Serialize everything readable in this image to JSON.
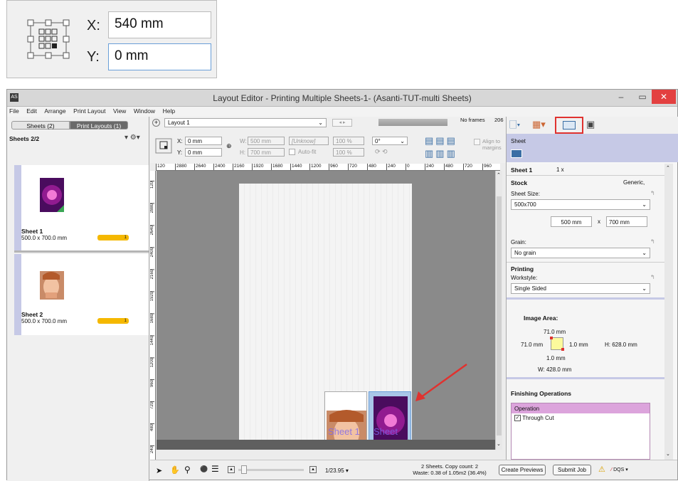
{
  "zoom": {
    "x_label": "X:",
    "x_value": "540 mm",
    "y_label": "Y:",
    "y_value": "0 mm"
  },
  "window": {
    "icon": "AS",
    "title": "Layout Editor - Printing Multiple Sheets-1- (Asanti-TUT-multi Sheets)"
  },
  "menu": [
    "File",
    "Edit",
    "Arrange",
    "Print Layout",
    "View",
    "Window",
    "Help"
  ],
  "left_tabs": {
    "sheets": "Sheets (2)",
    "layouts": "Print Layouts (1)"
  },
  "sheets_count": "Sheets 2/2",
  "sheets": [
    {
      "name": "Sheet 1",
      "size": "500.0 x 700.0 mm",
      "count": "1"
    },
    {
      "name": "Sheet 2",
      "size": "500.0 x 700.0 mm",
      "count": "1"
    }
  ],
  "toolbar": {
    "x_label": "X:",
    "x_value": "0 mm",
    "y_label": "Y:",
    "y_value": "0 mm",
    "w_label": "W:",
    "w_value": "500 mm",
    "h_label": "H:",
    "h_value": "700 mm",
    "unknown": "[Unknow]",
    "auto_fit": "Auto-fit",
    "pct1": "100 %",
    "pct2": "100 %",
    "angle": "0°",
    "align_to": "Align to",
    "margins": "margins",
    "layout_select": "Layout 1",
    "no_frames": "No frames",
    "frames_num": "206"
  },
  "ruler_h": [
    "120",
    "2880",
    "2640",
    "2400",
    "2160",
    "1920",
    "1680",
    "1440",
    "1200",
    "960",
    "720",
    "480",
    "240",
    "0",
    "240",
    "480",
    "720",
    "960"
  ],
  "ruler_v": [
    "120",
    "2880",
    "2640",
    "2400",
    "2160",
    "1920",
    "1680",
    "1440",
    "1200",
    "960",
    "720",
    "480",
    "240"
  ],
  "canvas": {
    "sheet_text_1": "Sheet 1",
    "sheet_text_2": "Sheet"
  },
  "right": {
    "panel_label": "Sheet",
    "title": "Sheet 1",
    "qty": "1 x",
    "stock_label": "Stock",
    "stock_value": "Generic,",
    "sheet_size_label": "Sheet Size:",
    "sheet_size_value": "500x700",
    "width": "500 mm",
    "x": "x",
    "height": "700 mm",
    "grain_label": "Grain:",
    "grain_value": "No grain",
    "printing_label": "Printing",
    "workstyle_label": "Workstyle:",
    "workstyle_value": "Single Sided",
    "image_area_label": "Image Area:",
    "top": "71.0 mm",
    "left": "71.0 mm",
    "right": "1.0 mm",
    "bottom": "1.0 mm",
    "h": "H: 628.0 mm",
    "w": "W: 428.0 mm",
    "finishing_label": "Finishing Operations",
    "operation_header": "Operation",
    "operation_item": "Through Cut"
  },
  "status": {
    "zoom": "1/23.95",
    "info1": "2 Sheets. Copy count: 2",
    "info2": "Waste: 0.38 of 1.05m2 (36.4%)",
    "create_previews": "Create Previews",
    "submit_job": "Submit Job",
    "dqs": "DQS"
  },
  "colors": {
    "accent": "#c6c9e6",
    "highlight_red": "#e0322f",
    "badge": "#f5b800",
    "close": "#e34040"
  }
}
